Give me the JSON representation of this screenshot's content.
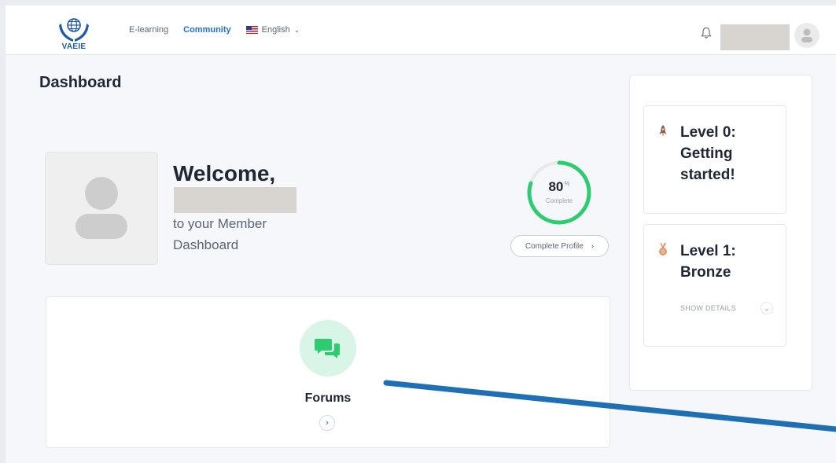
{
  "header": {
    "logo_text": "VAEIE",
    "nav": [
      {
        "label": "E-learning",
        "active": false
      },
      {
        "label": "Community",
        "active": true
      }
    ],
    "language": {
      "label": "English",
      "icon": "us-flag-icon"
    },
    "icons": {
      "notifications": "bell-icon",
      "avatar": "user-avatar-icon"
    }
  },
  "page": {
    "title": "Dashboard"
  },
  "profile": {
    "welcome": "Welcome,",
    "subtitle": "to your Member Dashboard",
    "completion": {
      "value": "80",
      "unit": "%",
      "label": "Complete",
      "fraction": 0.8
    },
    "complete_button": "Complete Profile",
    "colors": {
      "progress": "#2ecc71",
      "track": "#e6e9ed"
    }
  },
  "forums": {
    "title": "Forums",
    "icon": "chat-bubbles-icon",
    "accent": "#2ecc71"
  },
  "levels": [
    {
      "title": "Level 0: Getting started!",
      "icon": "rocket-icon"
    },
    {
      "title": "Level 1: Bronze",
      "icon": "bronze-medal-icon",
      "details_label": "SHOW DETAILS"
    }
  ],
  "colors": {
    "brand": "#1f6fd6",
    "annotation": "#1f6fb5"
  }
}
